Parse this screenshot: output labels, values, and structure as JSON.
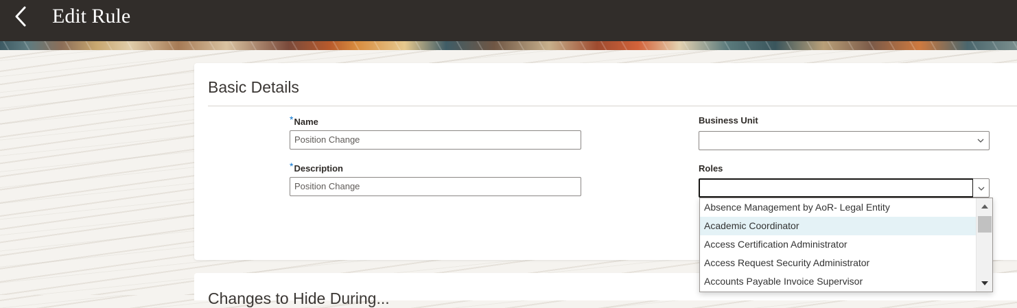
{
  "header": {
    "title": "Edit Rule",
    "back_icon": "chevron-left-icon"
  },
  "basic_details": {
    "section_title": "Basic Details",
    "name": {
      "label": "Name",
      "required_mark": "*",
      "value": "Position Change"
    },
    "description": {
      "label": "Description",
      "required_mark": "*",
      "value": "Position Change"
    },
    "business_unit": {
      "label": "Business Unit",
      "value": ""
    },
    "roles": {
      "label": "Roles",
      "value": "",
      "options": [
        "Absence Management by AoR- Legal Entity",
        "Academic Coordinator",
        "Access Certification Administrator",
        "Access Request Security Administrator",
        "Accounts Payable Invoice Supervisor"
      ],
      "highlighted_index": 1
    }
  },
  "next_section": {
    "title_partial": "Changes to Hide During..."
  },
  "colors": {
    "header_bg": "#312d2a",
    "required_asterisk": "#0572ce",
    "highlight": "#e4f2f6"
  }
}
